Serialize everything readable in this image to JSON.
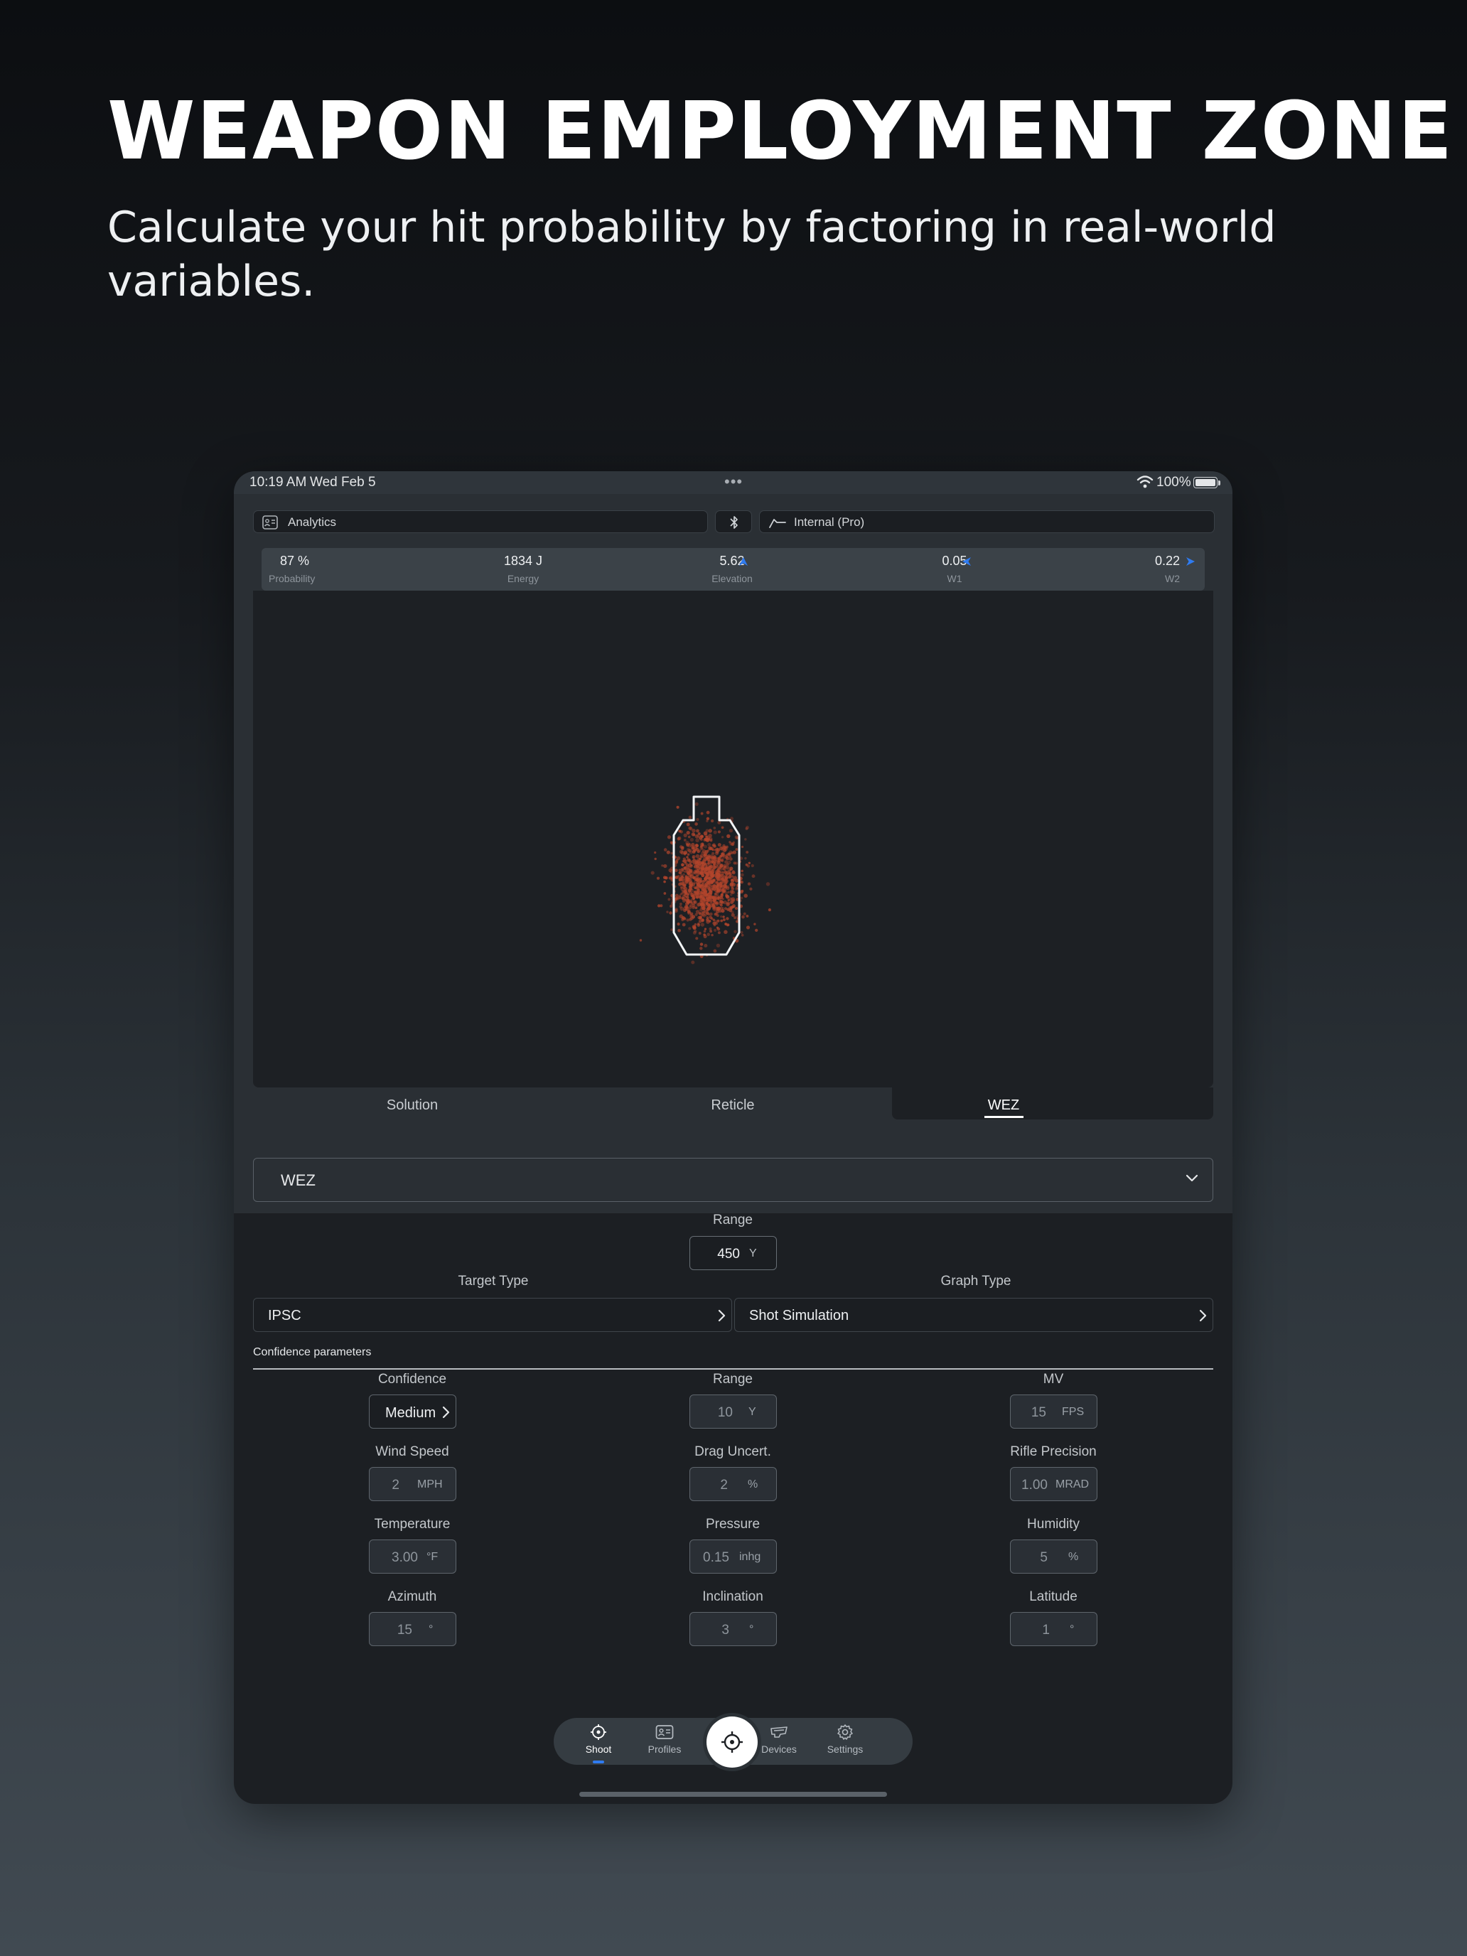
{
  "hero": {
    "title": "WEAPON EMPLOYMENT ZONE",
    "subtitle": "Calculate your hit probability by factoring in real-world variables."
  },
  "status_bar": {
    "time": "10:19 AM",
    "date": "Wed Feb 5",
    "battery": "100%"
  },
  "top_bar": {
    "analytics_label": "Analytics",
    "profile_label": "Internal (Pro)"
  },
  "stats": [
    {
      "value": "87 %",
      "label": "Probability"
    },
    {
      "value": "1834 J",
      "label": "Energy"
    },
    {
      "value": "5.62",
      "label": "Elevation"
    },
    {
      "value": "0.05",
      "label": "W1"
    },
    {
      "value": "0.22",
      "label": "W2"
    }
  ],
  "accent_color": "#2f7bf0",
  "shot_color": "#b3452c",
  "tabs": [
    {
      "label": "Solution",
      "active": false
    },
    {
      "label": "Reticle",
      "active": false
    },
    {
      "label": "WEZ",
      "active": true
    }
  ],
  "mode_select": {
    "value": "WEZ"
  },
  "range": {
    "label": "Range",
    "value": "450",
    "unit": "Y"
  },
  "target_type": {
    "label": "Target Type",
    "value": "IPSC"
  },
  "graph_type": {
    "label": "Graph Type",
    "value": "Shot Simulation"
  },
  "confidence_section": {
    "title": "Confidence parameters"
  },
  "params": [
    {
      "label": "Confidence",
      "value": "Medium"
    },
    {
      "label": "Range",
      "value": "10",
      "unit": "Y"
    },
    {
      "label": "MV",
      "value": "15",
      "unit": "FPS"
    },
    {
      "label": "Wind Speed",
      "value": "2",
      "unit": "MPH"
    },
    {
      "label": "Drag Uncert.",
      "value": "2",
      "unit": "%"
    },
    {
      "label": "Rifle Precision",
      "value": "1.00",
      "unit": "MRAD"
    },
    {
      "label": "Temperature",
      "value": "3.00",
      "unit": "°F"
    },
    {
      "label": "Pressure",
      "value": "0.15",
      "unit": "inhg"
    },
    {
      "label": "Humidity",
      "value": "5",
      "unit": "%"
    },
    {
      "label": "Azimuth",
      "value": "15",
      "unit": "°"
    },
    {
      "label": "Inclination",
      "value": "3",
      "unit": "°"
    },
    {
      "label": "Latitude",
      "value": "1",
      "unit": "°"
    }
  ],
  "tab_bar": [
    {
      "label": "Shoot",
      "icon": "crosshair-icon",
      "active": true
    },
    {
      "label": "Profiles",
      "icon": "id-card-icon",
      "active": false
    },
    {
      "label": "Devices",
      "icon": "device-icon",
      "active": false
    },
    {
      "label": "Settings",
      "icon": "gear-icon",
      "active": false
    }
  ]
}
